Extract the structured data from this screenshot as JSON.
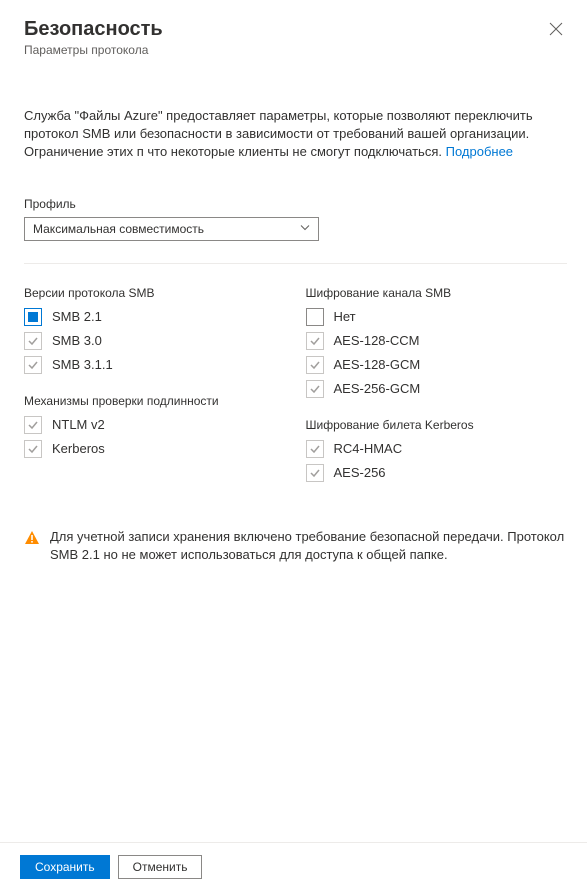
{
  "header": {
    "title": "Безопасность",
    "subtitle": "Параметры протокола"
  },
  "description": {
    "text": "Служба \"Файлы Azure\" предоставляет параметры, которые позволяют переключить протокол SMB или безопасности в зависимости от требований вашей организации. Ограничение этих п что некоторые клиенты не смогут подключаться.",
    "link": "Подробнее"
  },
  "profile": {
    "label": "Профиль",
    "value": "Максимальная совместимость"
  },
  "sections": {
    "smb_versions": {
      "label": "Версии протокола SMB",
      "items": [
        {
          "label": "SMB 2.1",
          "kind": "square-enabled"
        },
        {
          "label": "SMB 3.0",
          "kind": "checked-disabled"
        },
        {
          "label": "SMB 3.1.1",
          "kind": "checked-disabled"
        }
      ]
    },
    "channel_encryption": {
      "label": "Шифрование канала SMB",
      "items": [
        {
          "label": "Нет",
          "kind": "unchecked"
        },
        {
          "label": "AES-128-CCM",
          "kind": "checked-disabled"
        },
        {
          "label": "AES-128-GCM",
          "kind": "checked-disabled"
        },
        {
          "label": "AES-256-GCM",
          "kind": "checked-disabled"
        }
      ]
    },
    "auth_mechanisms": {
      "label": "Механизмы проверки подлинности",
      "items": [
        {
          "label": "NTLM v2",
          "kind": "checked-disabled"
        },
        {
          "label": "Kerberos",
          "kind": "checked-disabled"
        }
      ]
    },
    "kerberos_encryption": {
      "label": "Шифрование билета Kerberos",
      "items": [
        {
          "label": "RC4-HMAC",
          "kind": "checked-disabled"
        },
        {
          "label": "AES-256",
          "kind": "checked-disabled"
        }
      ]
    }
  },
  "warning": {
    "text": "Для учетной записи хранения включено требование безопасной передачи. Протокол SMB 2.1 но не может использоваться для доступа к общей папке."
  },
  "footer": {
    "save": "Сохранить",
    "cancel": "Отменить"
  }
}
